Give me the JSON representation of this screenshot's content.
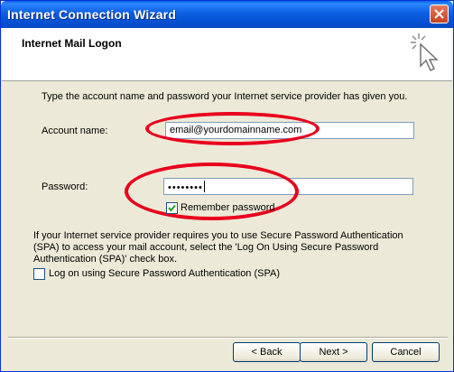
{
  "window": {
    "title": "Internet Connection Wizard"
  },
  "header": {
    "title": "Internet Mail Logon"
  },
  "intro_text": "Type the account name and password your Internet service provider has given you.",
  "account": {
    "label": "Account name:",
    "value": "email@yourdomainname.com"
  },
  "password": {
    "label": "Password:",
    "masked_value": "••••••••"
  },
  "remember_password": {
    "label": "Remember password",
    "checked": true
  },
  "spa": {
    "description": "If your Internet service provider requires you to use Secure Password Authentication (SPA) to access your mail account, select the 'Log On Using Secure Password Authentication (SPA)' check box.",
    "checkbox_label": "Log on using Secure Password Authentication (SPA)",
    "checked": false
  },
  "buttons": {
    "back": "< Back",
    "next": "Next >",
    "cancel": "Cancel"
  },
  "colors": {
    "titlebar": "#0654d6",
    "annotation": "#e8001c",
    "dialog_bg": "#ece9d8"
  },
  "icons": [
    "close-icon",
    "wizard-sparkle-icon",
    "checkmark-icon"
  ]
}
